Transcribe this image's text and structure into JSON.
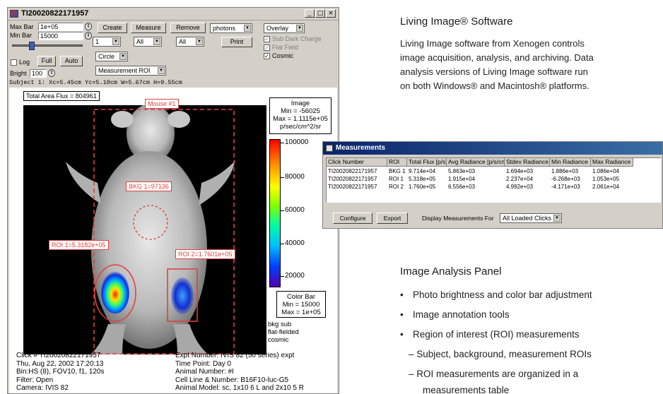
{
  "window": {
    "title": "TI20020822171957",
    "btn_min": "_",
    "btn_max": "□",
    "btn_close": "×"
  },
  "toolbar": {
    "max_bar_label": "Max Bar",
    "max_bar_value": "1e+05",
    "min_bar_label": "Min Bar",
    "min_bar_value": "15000",
    "create": "Create",
    "measure": "Measure",
    "remove": "Remove",
    "units_select": "photons",
    "overlay_select": "Overlay",
    "count_select": "1",
    "all_select_1": "All",
    "all_select_2": "All",
    "print": "Print",
    "sub_dark_charge": "Sub Dark Charge",
    "flat_field": "Flat Field",
    "cosmic": "Cosmic",
    "log": "Log",
    "full": "Full",
    "auto": "Auto",
    "shape_select": "Circle",
    "roi_type_select": "Measurement ROI",
    "bright_label": "Bright",
    "bright_value": "100",
    "subject_line": "Subject 1: Xc=5.45cm Yc=5.10cm W=5.67cm H=9.55cm"
  },
  "image": {
    "total_flux": "Total Area Flux = 804961",
    "mouse_label": "Mouse #1",
    "bkg_label": "BKG 1=97136",
    "roi1_label": "ROI 1=5.3182e+05",
    "roi2_label": "ROI 2=1.7601e+05",
    "info_image": "Image",
    "info_min": "Min = -56025",
    "info_max": "Max = 1.1115e+05",
    "info_units": "p/sec/cm^2/sr",
    "ticks": [
      "100000",
      "80000",
      "60000",
      "40000",
      "20000"
    ],
    "colorbar_title": "Color Bar",
    "colorbar_min": "Min = 15000",
    "colorbar_max": "Max = 1e+05",
    "note_bkg_sub": "bkg sub",
    "note_flat": "flat-fielded",
    "note_cosmic": "cosmic",
    "footer_left": [
      "Click # TI20020822171957",
      "Thu, Aug 22, 2002 17:20:13",
      "Bin:HS (8), FOV10, f1, 120s",
      "Filter: Open",
      "Camera: IVIS 82"
    ],
    "footer_right": [
      "Expt Number: IVIS 82 (50 series) expt",
      "Time Point: Day 0",
      "Animal Number: #I",
      "Cell Line & Number: B16F10-luc-G5",
      "Animal Model: sc, 1x10 6 L and 2x10 5 R"
    ]
  },
  "measurements": {
    "title": "Measurements",
    "columns": [
      "Click Number",
      "ROI",
      "Total Flux [p/s]",
      "Avg Radiance [p/s/cm",
      "Stdev Radiance",
      "Min Radiance",
      "Max Radiance"
    ],
    "rows": [
      [
        "TI20020822171957",
        "BKG 1",
        "9.714e+04",
        "5.863e+03",
        "1.694e+03",
        "1.886e+03",
        "1.086e+04"
      ],
      [
        "TI20020822171957",
        "ROI 1",
        "5.318e+05",
        "1.915e+04",
        "2.237e+04",
        "-6.268e+03",
        "1.053e+05"
      ],
      [
        "TI20020822171957",
        "ROI 2",
        "1.760e+05",
        "6.556e+03",
        "4.992e+03",
        "-4.171e+03",
        "2.061e+04"
      ]
    ],
    "configure": "Configure",
    "export": "Export",
    "display_label": "Display Measurements For",
    "display_select": "All Loaded Clicks"
  },
  "text": {
    "heading1": "Living Image® Software",
    "para": [
      "Living Image software from Xenogen controls",
      "image acquisition, analysis, and archiving. Data",
      "analysis versions of Living Image software run",
      "on both Windows® and Macintosh® platforms."
    ],
    "heading2": "Image Analysis Panel",
    "bullets": [
      "Photo brightness and color bar adjustment",
      "Image annotation tools",
      "Region of interest (ROI) measurements"
    ],
    "subbullets": [
      "– Subject, background, measurement ROIs",
      "– ROI measurements are organized in a",
      "measurements table"
    ]
  }
}
